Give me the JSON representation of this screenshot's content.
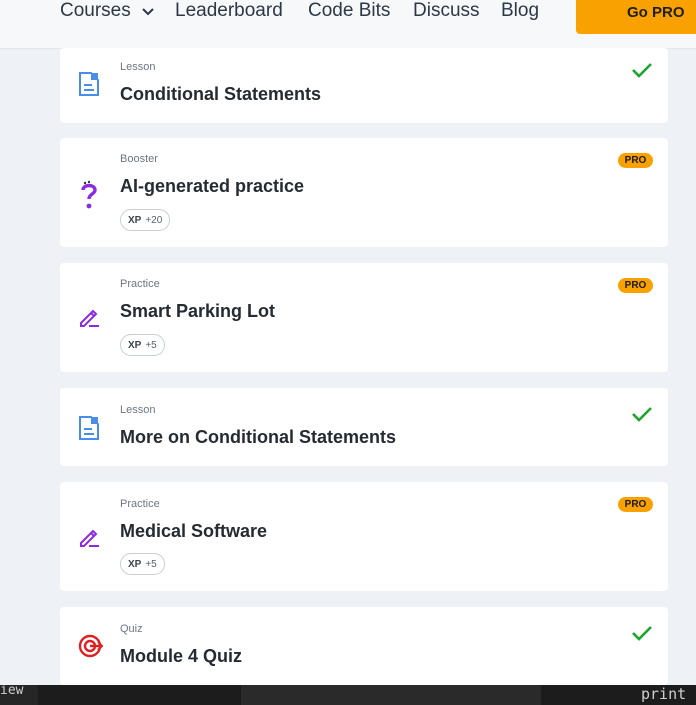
{
  "nav": {
    "items": [
      "Courses",
      "Leaderboard",
      "Code Bits",
      "Discuss",
      "Blog"
    ],
    "cta": "Go PRO"
  },
  "cards": [
    {
      "type": "Lesson",
      "title": "Conditional Statements",
      "status": "completed"
    },
    {
      "type": "Booster",
      "title": "AI-generated practice",
      "badge": "PRO",
      "xp_label": "XP",
      "xp_value": "+20"
    },
    {
      "type": "Practice",
      "title": "Smart Parking Lot",
      "badge": "PRO",
      "xp_label": "XP",
      "xp_value": "+5"
    },
    {
      "type": "Lesson",
      "title": "More on Conditional Statements",
      "status": "completed"
    },
    {
      "type": "Practice",
      "title": "Medical Software",
      "badge": "PRO",
      "xp_label": "XP",
      "xp_value": "+5"
    },
    {
      "type": "Quiz",
      "title": "Module 4 Quiz",
      "status": "completed"
    }
  ],
  "bottom_bar": {
    "left_text": "iew",
    "right_text": "print"
  },
  "colors": {
    "accent": "#f8a100",
    "check": "#1fa52f",
    "lesson_icon": "#4a8de8",
    "practice_icon": "#8a2be2",
    "quiz_icon": "#e02020"
  }
}
